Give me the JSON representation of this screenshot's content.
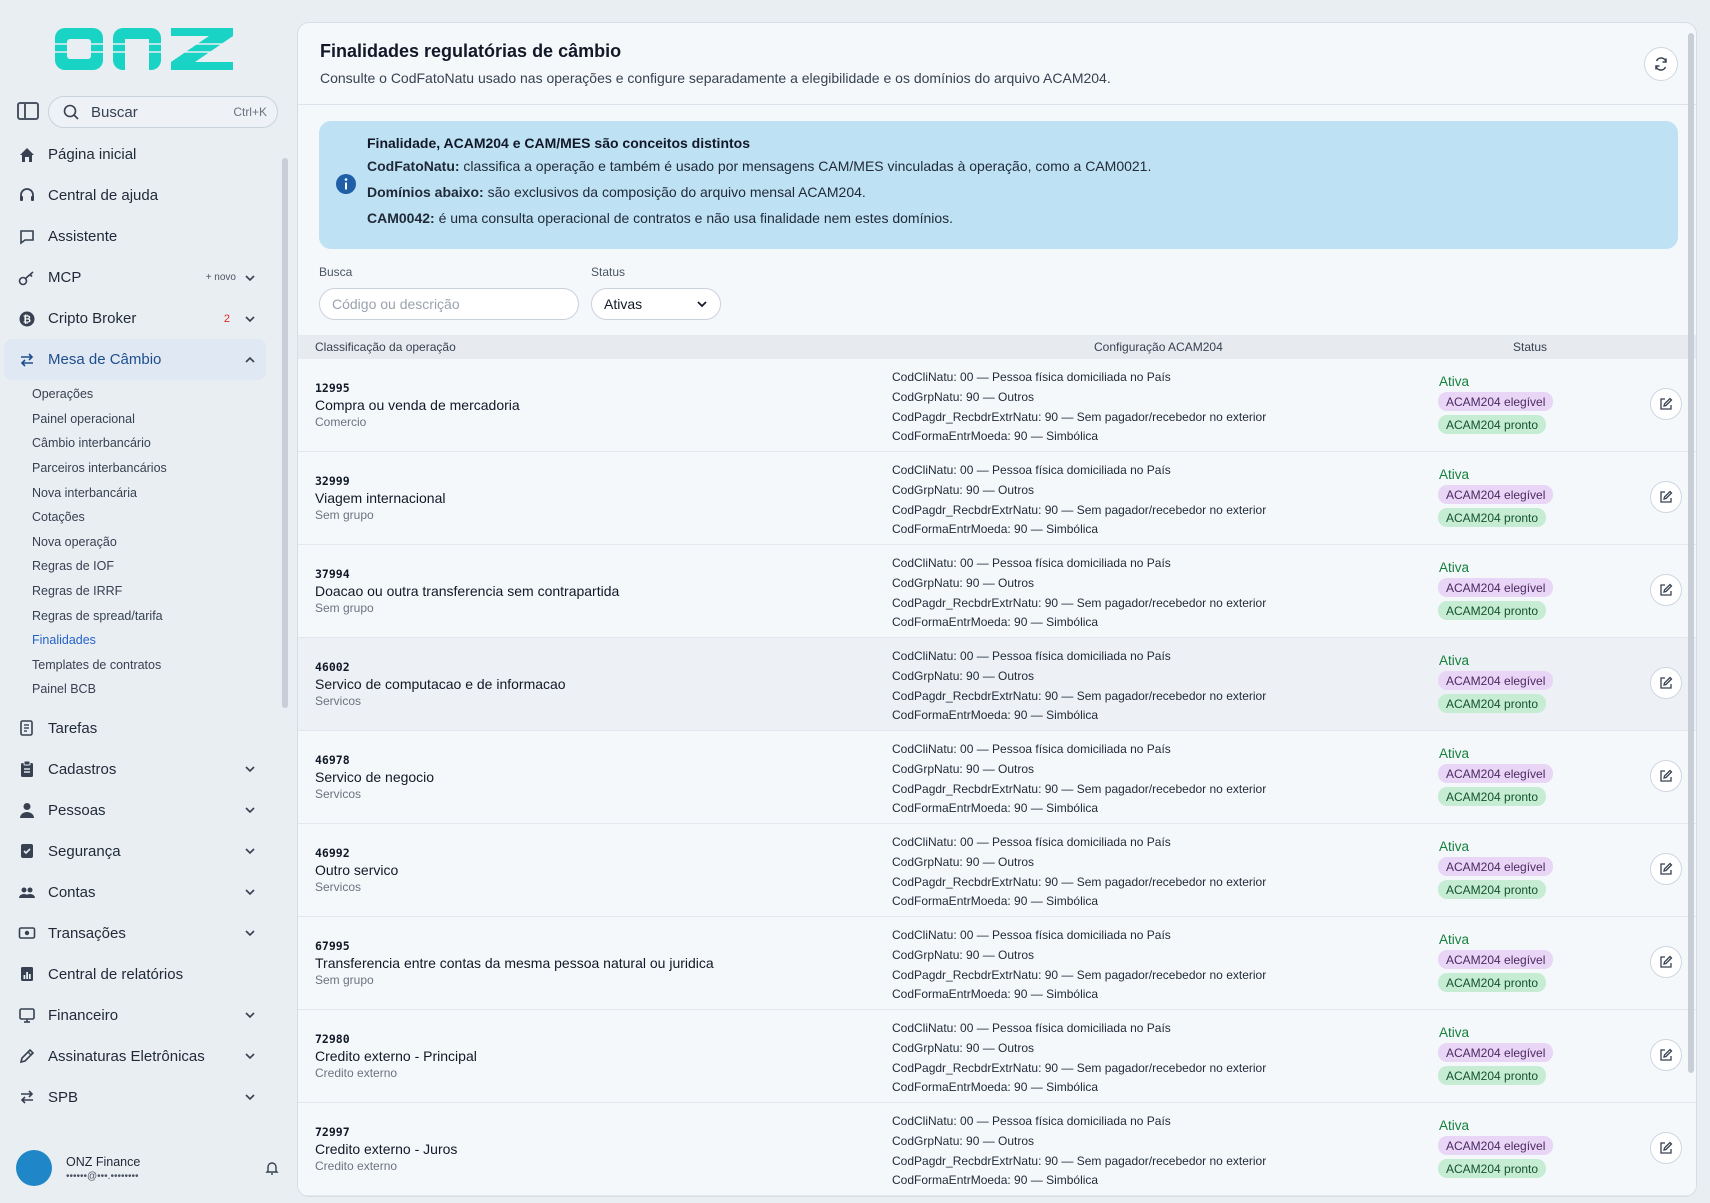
{
  "brand": {
    "logo_text": "onz",
    "color": "#19d3c5"
  },
  "sidebar": {
    "search": {
      "label": "Buscar",
      "shortcut": "Ctrl+K"
    },
    "items": [
      {
        "label": "Página inicial",
        "icon": "home-icon"
      },
      {
        "label": "Central de ajuda",
        "icon": "headset-icon"
      },
      {
        "label": "Assistente",
        "icon": "chat-icon"
      },
      {
        "label": "MCP",
        "icon": "key-icon",
        "tag": "+ novo"
      },
      {
        "label": "Cripto Broker",
        "icon": "bitcoin-icon",
        "badge": "2"
      },
      {
        "label": "Mesa de Câmbio",
        "icon": "exchange-icon"
      },
      {
        "label": "Tarefas",
        "icon": "task-icon"
      },
      {
        "label": "Cadastros",
        "icon": "clipboard-icon"
      },
      {
        "label": "Pessoas",
        "icon": "person-icon"
      },
      {
        "label": "Segurança",
        "icon": "shield-icon"
      },
      {
        "label": "Contas",
        "icon": "people-icon"
      },
      {
        "label": "Transações",
        "icon": "cash-icon"
      },
      {
        "label": "Central de relatórios",
        "icon": "report-icon"
      },
      {
        "label": "Financeiro",
        "icon": "finance-icon"
      },
      {
        "label": "Assinaturas Eletrônicas",
        "icon": "signature-icon"
      },
      {
        "label": "SPB",
        "icon": "transfer-icon"
      }
    ],
    "sub_items": [
      "Operações",
      "Painel operacional",
      "Câmbio interbancário",
      "Parceiros interbancários",
      "Nova interbancária",
      "Cotações",
      "Nova operação",
      "Regras de IOF",
      "Regras de IRRF",
      "Regras de spread/tarifa",
      "Finalidades",
      "Templates de contratos",
      "Painel BCB"
    ],
    "user": {
      "name": "ONZ Finance",
      "email": "••••••@•••.••••••••"
    }
  },
  "main": {
    "title": "Finalidades regulatórias de câmbio",
    "subtitle": "Consulte o CodFatoNatu usado nas operações e configure separadamente a elegibilidade e os domínios do arquivo ACAM204.",
    "info": {
      "title": "Finalidade, ACAM204 e CAM/MES são conceitos distintos",
      "l1_b": "CodFatoNatu:",
      "l1": " classifica a operação e também é usado por mensagens CAM/MES vinculadas à operação, como a CAM0021.",
      "l2_b": "Domínios abaixo:",
      "l2": " são exclusivos da composição do arquivo mensal ACAM204.",
      "l3_b": "CAM0042:",
      "l3": " é uma consulta operacional de contratos e não usa finalidade nem estes domínios."
    },
    "filters": {
      "search_label": "Busca",
      "search_placeholder": "Código ou descrição",
      "status_label": "Status",
      "status_value": "Ativas"
    },
    "table": {
      "headers": [
        "Classificação da operação",
        "Configuração ACAM204",
        "Status"
      ],
      "rows": [
        {
          "code": "12995",
          "desc": "Compra ou venda de mercadoria",
          "group": "Comercio",
          "cfg": [
            "CodCliNatu: 00 — Pessoa física domiciliada no País",
            "CodGrpNatu: 90 — Outros",
            "CodPagdr_RecbdrExtrNatu: 90 — Sem pagador/recebedor no exterior",
            "CodFormaEntrMoeda: 90 — Simbólica"
          ],
          "status": "Ativa",
          "b1": "ACAM204 elegível",
          "b2": "ACAM204 pronto"
        },
        {
          "code": "32999",
          "desc": "Viagem internacional",
          "group": "Sem grupo",
          "cfg": [
            "CodCliNatu: 00 — Pessoa física domiciliada no País",
            "CodGrpNatu: 90 — Outros",
            "CodPagdr_RecbdrExtrNatu: 90 — Sem pagador/recebedor no exterior",
            "CodFormaEntrMoeda: 90 — Simbólica"
          ],
          "status": "Ativa",
          "b1": "ACAM204 elegível",
          "b2": "ACAM204 pronto"
        },
        {
          "code": "37994",
          "desc": "Doacao ou outra transferencia sem contrapartida",
          "group": "Sem grupo",
          "cfg": [
            "CodCliNatu: 00 — Pessoa física domiciliada no País",
            "CodGrpNatu: 90 — Outros",
            "CodPagdr_RecbdrExtrNatu: 90 — Sem pagador/recebedor no exterior",
            "CodFormaEntrMoeda: 90 — Simbólica"
          ],
          "status": "Ativa",
          "b1": "ACAM204 elegível",
          "b2": "ACAM204 pronto"
        },
        {
          "code": "46002",
          "desc": "Servico de computacao e de informacao",
          "group": "Servicos",
          "cfg": [
            "CodCliNatu: 00 — Pessoa física domiciliada no País",
            "CodGrpNatu: 90 — Outros",
            "CodPagdr_RecbdrExtrNatu: 90 — Sem pagador/recebedor no exterior",
            "CodFormaEntrMoeda: 90 — Simbólica"
          ],
          "status": "Ativa",
          "b1": "ACAM204 elegível",
          "b2": "ACAM204 pronto"
        },
        {
          "code": "46978",
          "desc": "Servico de negocio",
          "group": "Servicos",
          "cfg": [
            "CodCliNatu: 00 — Pessoa física domiciliada no País",
            "CodGrpNatu: 90 — Outros",
            "CodPagdr_RecbdrExtrNatu: 90 — Sem pagador/recebedor no exterior",
            "CodFormaEntrMoeda: 90 — Simbólica"
          ],
          "status": "Ativa",
          "b1": "ACAM204 elegível",
          "b2": "ACAM204 pronto"
        },
        {
          "code": "46992",
          "desc": "Outro servico",
          "group": "Servicos",
          "cfg": [
            "CodCliNatu: 00 — Pessoa física domiciliada no País",
            "CodGrpNatu: 90 — Outros",
            "CodPagdr_RecbdrExtrNatu: 90 — Sem pagador/recebedor no exterior",
            "CodFormaEntrMoeda: 90 — Simbólica"
          ],
          "status": "Ativa",
          "b1": "ACAM204 elegível",
          "b2": "ACAM204 pronto"
        },
        {
          "code": "67995",
          "desc": "Transferencia entre contas da mesma pessoa natural ou juridica",
          "group": "Sem grupo",
          "cfg": [
            "CodCliNatu: 00 — Pessoa física domiciliada no País",
            "CodGrpNatu: 90 — Outros",
            "CodPagdr_RecbdrExtrNatu: 90 — Sem pagador/recebedor no exterior",
            "CodFormaEntrMoeda: 90 — Simbólica"
          ],
          "status": "Ativa",
          "b1": "ACAM204 elegível",
          "b2": "ACAM204 pronto"
        },
        {
          "code": "72980",
          "desc": "Credito externo - Principal",
          "group": "Credito externo",
          "cfg": [
            "CodCliNatu: 00 — Pessoa física domiciliada no País",
            "CodGrpNatu: 90 — Outros",
            "CodPagdr_RecbdrExtrNatu: 90 — Sem pagador/recebedor no exterior",
            "CodFormaEntrMoeda: 90 — Simbólica"
          ],
          "status": "Ativa",
          "b1": "ACAM204 elegível",
          "b2": "ACAM204 pronto"
        },
        {
          "code": "72997",
          "desc": "Credito externo - Juros",
          "group": "Credito externo",
          "cfg": [
            "CodCliNatu: 00 — Pessoa física domiciliada no País",
            "CodGrpNatu: 90 — Outros",
            "CodPagdr_RecbdrExtrNatu: 90 — Sem pagador/recebedor no exterior",
            "CodFormaEntrMoeda: 90 — Simbólica"
          ],
          "status": "Ativa",
          "b1": "ACAM204 elegível",
          "b2": "ACAM204 pronto"
        }
      ]
    }
  }
}
